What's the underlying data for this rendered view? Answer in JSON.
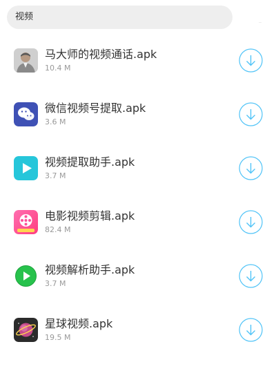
{
  "search": {
    "query": "视频"
  },
  "apps": [
    {
      "name": "马大师的视频通话.apk",
      "size": "10.4 M",
      "icon": "portrait-photo-icon"
    },
    {
      "name": "微信视频号提取.apk",
      "size": "3.6 M",
      "icon": "wechat-icon"
    },
    {
      "name": "视频提取助手.apk",
      "size": "3.7 M",
      "icon": "play-icon"
    },
    {
      "name": "电影视频剪辑.apk",
      "size": "82.4 M",
      "icon": "film-reel-icon"
    },
    {
      "name": "视频解析助手.apk",
      "size": "3.7 M",
      "icon": "green-play-icon"
    },
    {
      "name": "星球视频.apk",
      "size": "19.5 M",
      "icon": "planet-icon"
    }
  ],
  "colors": {
    "accent": "#4fc3f7",
    "wechat_bg": "#3f51b5",
    "play_bg": "#26c6da",
    "film_bg": "#ff4f9a",
    "green_play": "#27c24c",
    "planet_bg": "#2b2b2b"
  }
}
